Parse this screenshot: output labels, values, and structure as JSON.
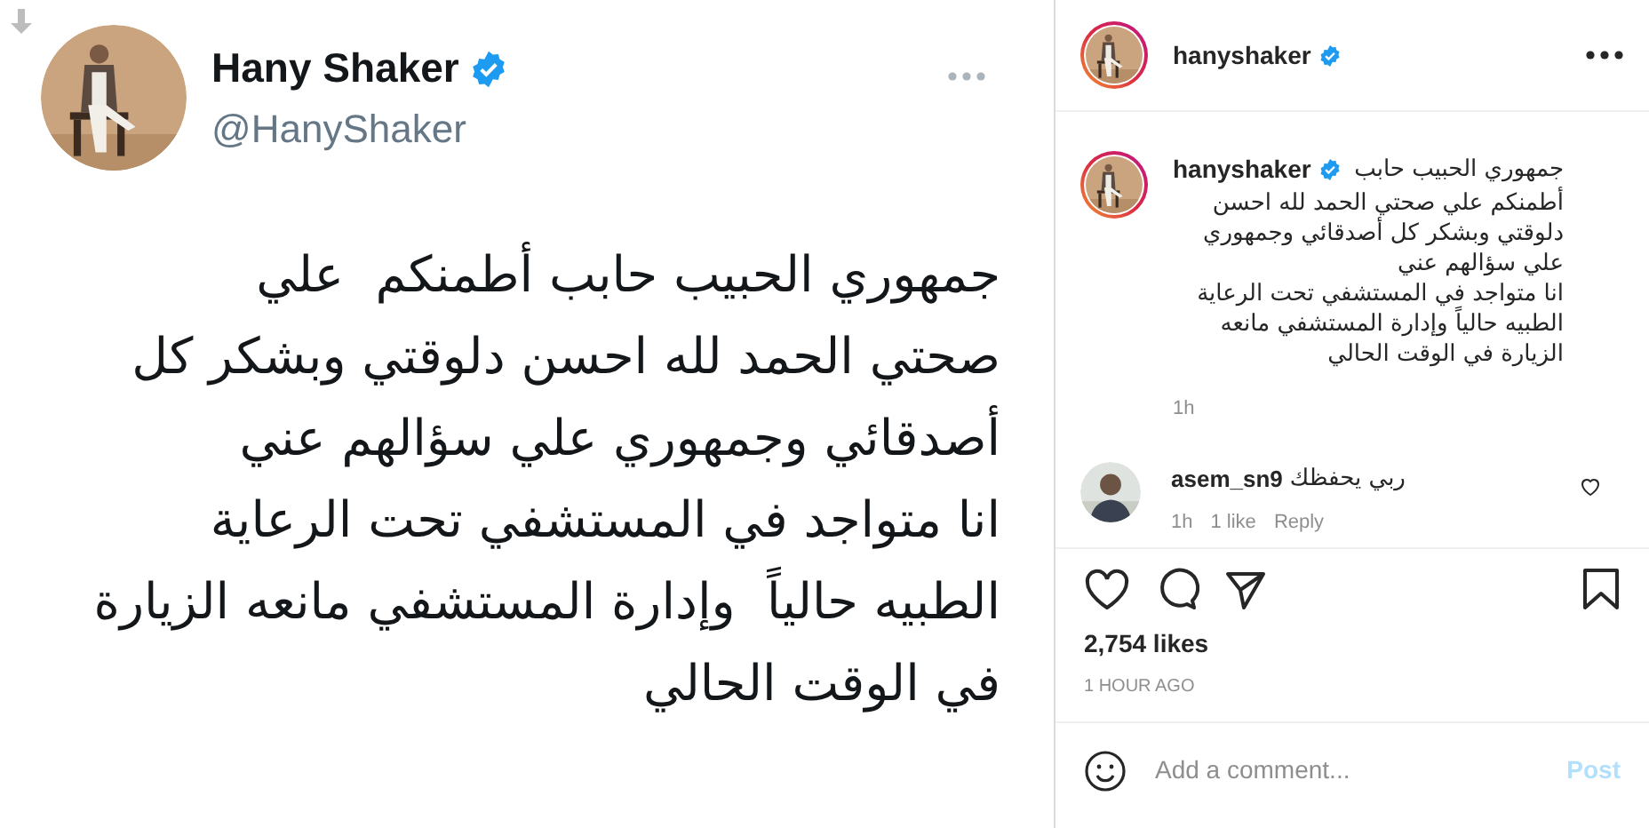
{
  "tweet": {
    "name": "Hany Shaker",
    "verified": true,
    "handle": "@HanyShaker",
    "lines": [
      "جمهوري الحبيب حابب أطمنكم  علي",
      "صحتي الحمد لله احسن دلوقتي وبشكر كل",
      "أصدقائي وجمهوري علي سؤالهم عني",
      "انا متواجد في المستشفي تحت الرعاية",
      "الطبيه حالياً  وإدارة المستشفي مانعه الزيارة",
      "في الوقت الحالي"
    ]
  },
  "header": {
    "username": "hanyshaker",
    "verified": true
  },
  "caption": {
    "username": "hanyshaker",
    "verified": true,
    "first_line": "جمهوري الحبيب حابب",
    "lines": [
      "أطمنكم علي صحتي الحمد لله احسن",
      "دلوقتي وبشكر كل أصدقائي وجمهوري",
      "علي سؤالهم عني",
      "انا متواجد في المستشفي تحت الرعاية",
      "الطبيه حالياً وإدارة المستشفي مانعه",
      "الزيارة في الوقت الحالي"
    ],
    "time": "1h"
  },
  "comments": [
    {
      "username": "asem_sn9",
      "text": "ربي يحفظك",
      "time": "1h",
      "likes": "1 like",
      "reply": "Reply",
      "liked": false
    }
  ],
  "likes": "2,754 likes",
  "posted": "1 HOUR AGO",
  "comment_field": {
    "placeholder": "Add a comment...",
    "post": "Post",
    "post_enabled": false
  }
}
